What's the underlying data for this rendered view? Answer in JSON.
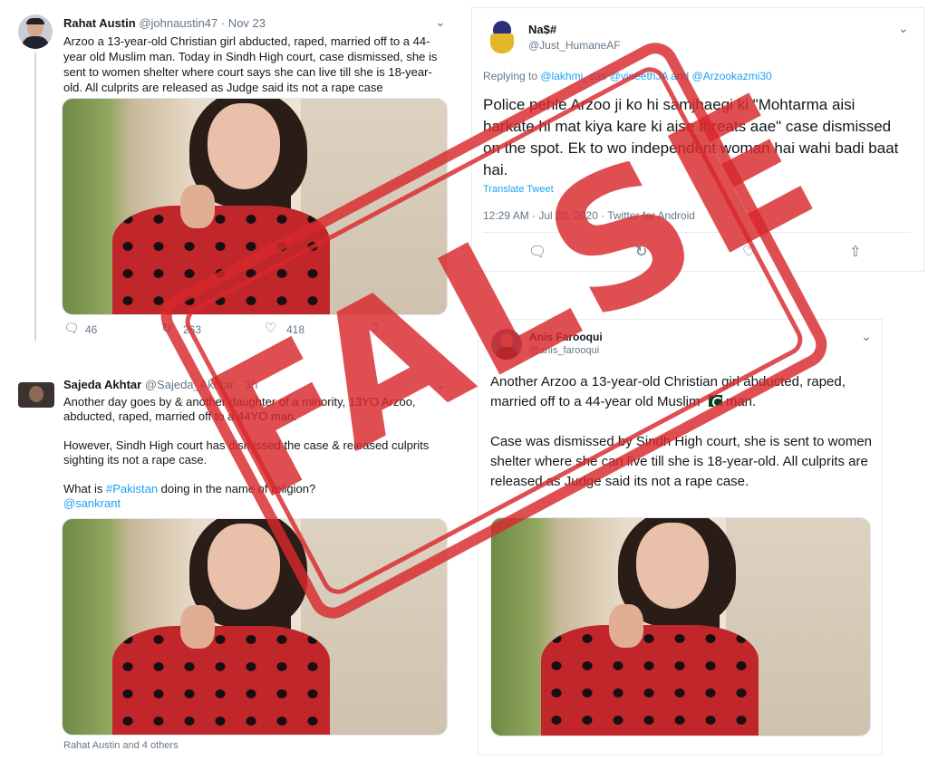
{
  "tweets": {
    "rahat": {
      "name": "Rahat Austin",
      "handle_date": "@johnaustin47 · Nov 23",
      "text": "Arzoo a 13-year-old Christian girl abducted, raped, married off to a 44-year old Muslim man. Today in Sindh High court, case dismissed, she is sent to women shelter where court says she can live till she is 18-year-old. All culprits are released as Judge said its not a rape case",
      "replies": "46",
      "retweets": "263",
      "likes": "418"
    },
    "nas": {
      "name": "Na$#",
      "handle": "@Just_HumaneAF",
      "replying_prefix": "Replying to",
      "replying_to": "@lakhmi_das @vineethJA and @Arzookazmi30",
      "text": "Police pehle Arzoo ji ko hi samjhaegi ki \"Mohtarma aisi harkate hi mat kiya kare ki aise threats aae\" case dismissed on the spot. Ek to wo independent woman hai wahi badi baat hai.",
      "translate": "Translate Tweet",
      "meta": "12:29 AM · Jul 20, 2020 · Twitter for Android"
    },
    "sajeda": {
      "name": "Sajeda Akhtar",
      "handle_date": "@Sajeda_Akhtar · 3h",
      "text_1": "Another day goes by & another daughter of a minority, 13YO Arzoo, abducted, raped, married off to a 44YO man.",
      "text_2": "However, Sindh High court has dismissed the case & released culprits sighting its not a rape case.",
      "text_3_prefix": "What is ",
      "hashtag": "#Pakistan",
      "text_3_suffix": " doing in the name of religion?",
      "mention": "@sankrant",
      "footer": "Rahat Austin and 4 others"
    },
    "anis": {
      "name": "Anis Farooqui",
      "handle": "@anis_farooqui",
      "text_1": "Another Arzoo a 13-year-old Christian girl abducted, raped, married off to a 44-year old Muslim",
      "text_1_end": "man.",
      "text_2": "Case was dismissed by Sindh High court, she is sent to women shelter where she can live till she is 18-year-old. All culprits are released as Judge said its not a rape case."
    }
  },
  "stamp": {
    "text": "FALSE",
    "color": "#d8282c"
  },
  "colors": {
    "link": "#1da1f2",
    "muted": "#657786"
  }
}
